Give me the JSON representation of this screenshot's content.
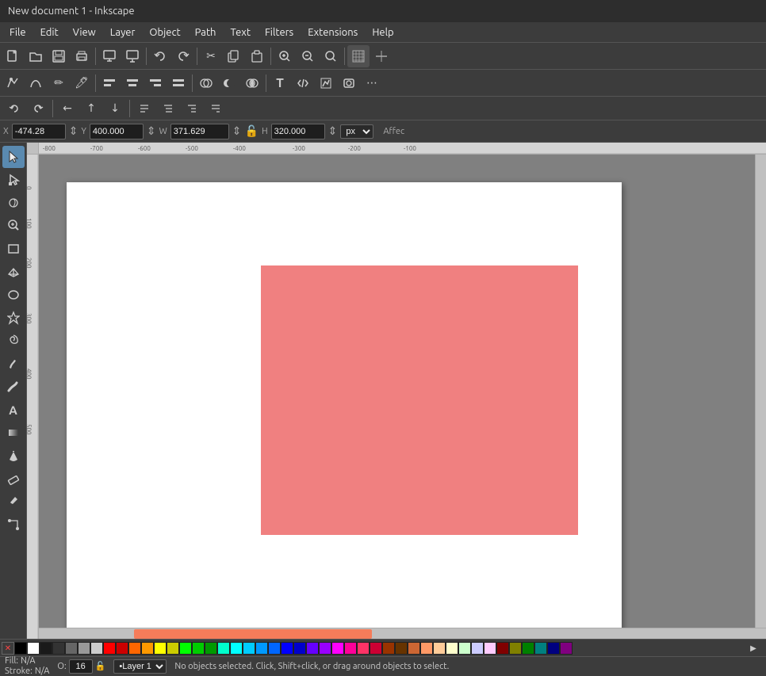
{
  "titlebar": {
    "title": "New document 1 - Inkscape"
  },
  "menubar": {
    "items": [
      "File",
      "Edit",
      "View",
      "Layer",
      "Object",
      "Path",
      "Text",
      "Filters",
      "Extensions",
      "Help"
    ]
  },
  "toolbar1": {
    "buttons": [
      "new",
      "open",
      "save",
      "print",
      "import",
      "export",
      "undo",
      "redo",
      "cut",
      "copy",
      "paste",
      "zoom-in",
      "zoom-out",
      "zoom-fit",
      "snap-grid",
      "snap-guide",
      "more"
    ]
  },
  "toolbar2": {
    "buttons": [
      "node",
      "bezier",
      "pencil",
      "pen",
      "calligraphy",
      "bucket",
      "gradient",
      "dropper",
      "text",
      "connector",
      "measure"
    ]
  },
  "coords": {
    "x_label": "X",
    "x_value": "-474.28",
    "y_label": "Y",
    "y_value": "400.000",
    "w_label": "W",
    "w_value": "371.629",
    "h_label": "H",
    "h_value": "320.000",
    "unit": "px",
    "affect_label": "Affec"
  },
  "statusbar": {
    "fill_label": "Fill:",
    "fill_value": "N/A",
    "stroke_label": "Stroke:",
    "stroke_value": "N/A",
    "opacity_label": "O:",
    "opacity_value": "16",
    "lock_icon": "🔒",
    "layer_label": "•Layer 1",
    "message": "No objects selected. Click, Shift+click, or drag around objects to select."
  },
  "palette": {
    "colors": [
      "#000000",
      "#ffffff",
      "#ff0000",
      "#00ff00",
      "#0000ff",
      "#ffff00",
      "#ff00ff",
      "#00ffff",
      "#ff8800",
      "#8800ff",
      "#0088ff",
      "#88ff00",
      "#ff0088",
      "#00ff88",
      "#888888",
      "#444444",
      "#cccccc",
      "#ff4444",
      "#44ff44",
      "#4444ff",
      "#ffaa44",
      "#aa44ff",
      "#44aaff",
      "#aaff44",
      "#ff44aa",
      "#44ffaa",
      "#884400",
      "#004488",
      "#448800",
      "#880044"
    ]
  },
  "canvas": {
    "shape_fill": "#f08080",
    "page_bg": "#ffffff"
  },
  "rulers": {
    "top_labels": [
      "-800",
      "-700",
      "-600",
      "-500",
      "-400",
      "-300",
      "-200",
      "-100"
    ],
    "left_labels": [
      "0",
      "100",
      "200",
      "300",
      "400",
      "500"
    ]
  }
}
